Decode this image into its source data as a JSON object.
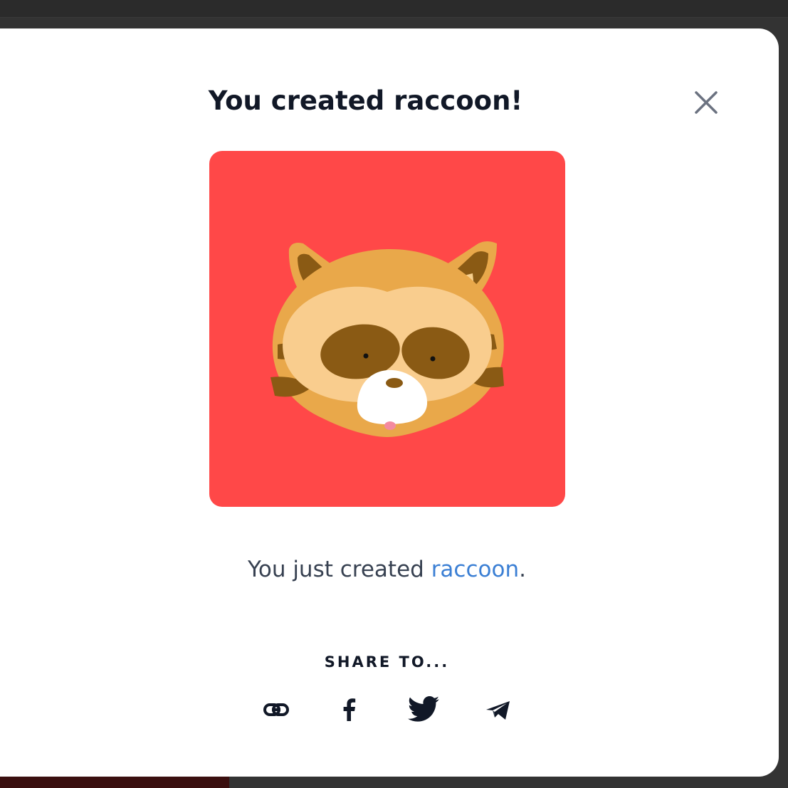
{
  "modal": {
    "title": "You created raccoon!",
    "close_icon": "close-icon"
  },
  "result": {
    "prefix": "You just created ",
    "animal_link": "raccoon",
    "suffix": ".",
    "image_bg_color": "#ff4848",
    "image_subject": "raccoon-face"
  },
  "share": {
    "label": "SHARE TO...",
    "targets": [
      {
        "name": "copy-link",
        "icon": "link-icon"
      },
      {
        "name": "facebook",
        "icon": "facebook-icon"
      },
      {
        "name": "twitter",
        "icon": "twitter-icon"
      },
      {
        "name": "telegram",
        "icon": "telegram-icon"
      }
    ]
  },
  "colors": {
    "link": "#3b7fd4",
    "title": "#111827",
    "body_text": "#374151",
    "close": "#6b7280"
  }
}
